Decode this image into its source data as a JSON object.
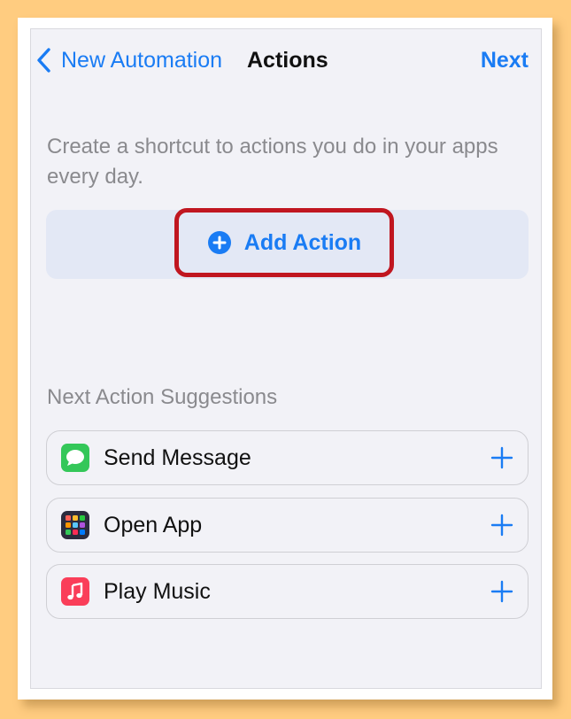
{
  "nav": {
    "back_label": "New Automation",
    "title": "Actions",
    "next_label": "Next"
  },
  "intro_text": "Create a shortcut to actions you do in your apps every day.",
  "add_action": {
    "label": "Add Action"
  },
  "suggestions": {
    "title": "Next Action Suggestions",
    "items": [
      {
        "label": "Send Message",
        "icon": "messages-app-icon",
        "color": "#34c759"
      },
      {
        "label": "Open App",
        "icon": "app-grid-icon",
        "color": "#2c2c3e"
      },
      {
        "label": "Play Music",
        "icon": "music-app-icon",
        "color": "#fa3e59"
      }
    ]
  },
  "colors": {
    "accent": "#1a7cf4",
    "highlight_border": "#c01620",
    "background": "#f2f2f7"
  }
}
